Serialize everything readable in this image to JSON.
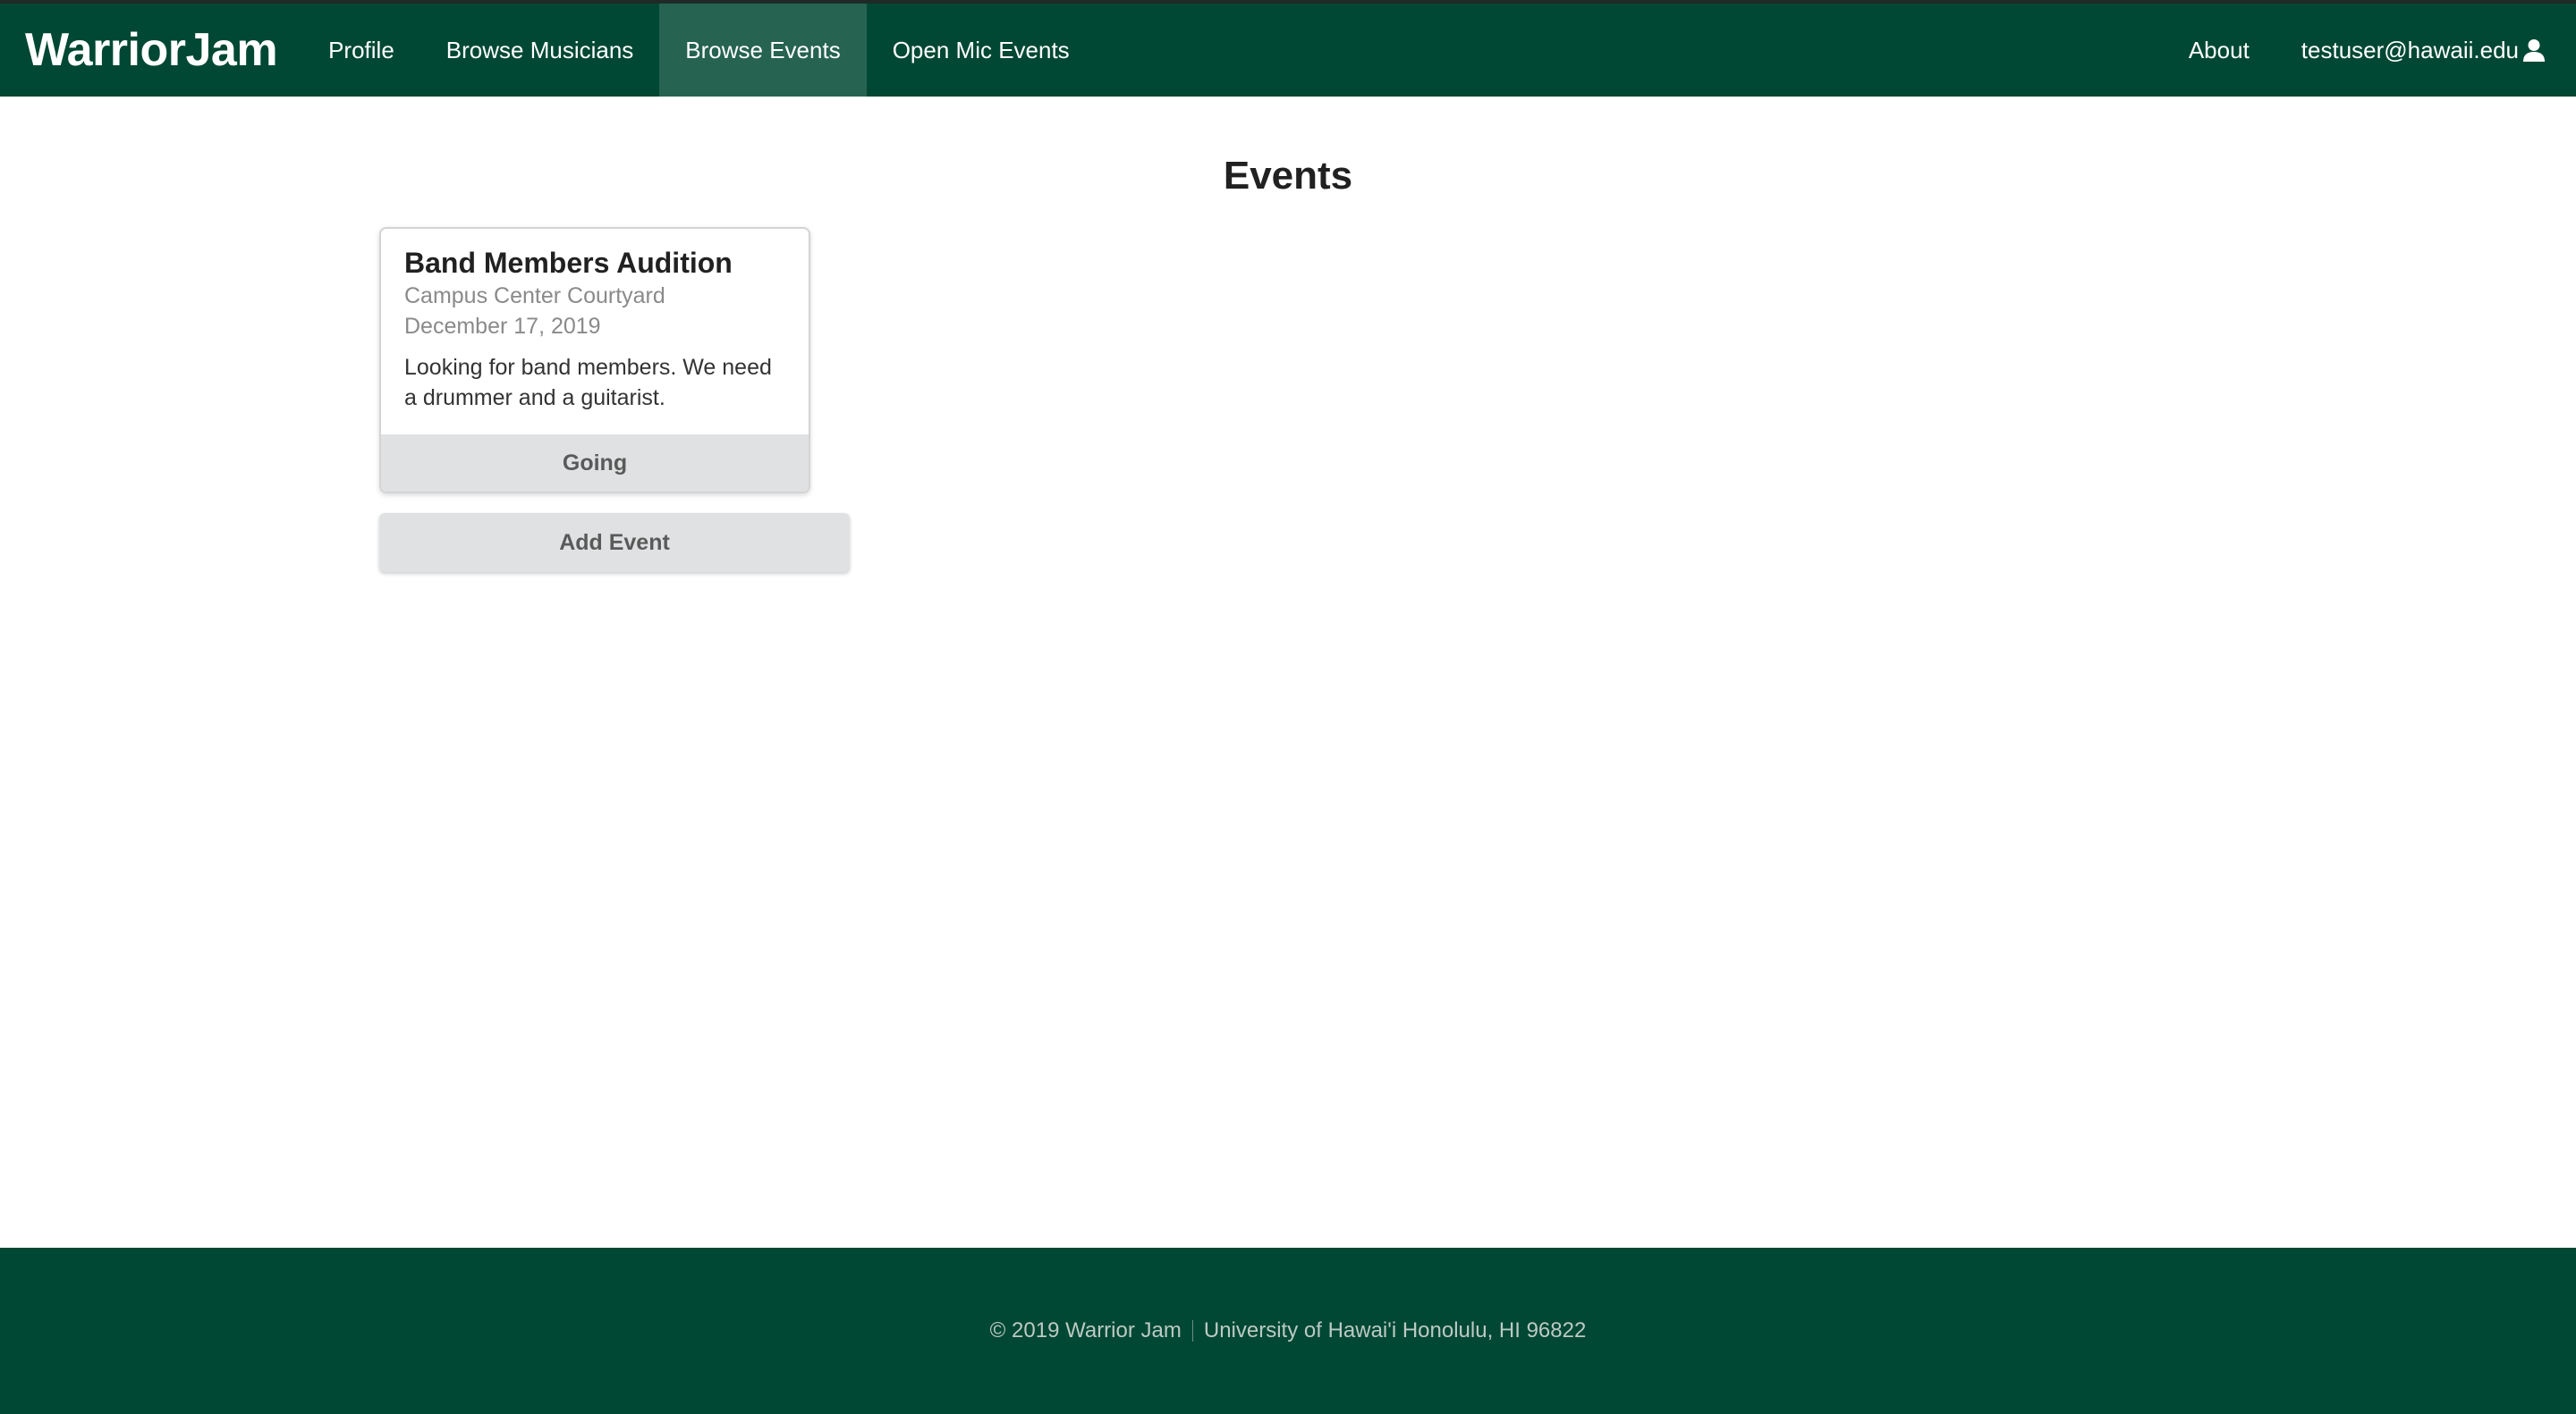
{
  "navbar": {
    "brand": "WarriorJam",
    "items": [
      {
        "label": "Profile"
      },
      {
        "label": "Browse Musicians"
      },
      {
        "label": "Browse Events"
      },
      {
        "label": "Open Mic Events"
      }
    ],
    "active_item": "Browse Events",
    "about_label": "About",
    "user_email": "testuser@hawaii.edu",
    "user_icon": "user-icon"
  },
  "page": {
    "title": "Events"
  },
  "events": [
    {
      "name": "Band Members Audition",
      "location": "Campus Center Courtyard",
      "date": "December 17, 2019",
      "description": "Looking for band members. We need a drummer and a guitarist.",
      "action_label": "Going"
    }
  ],
  "add_event_label": "Add Event",
  "footer": {
    "copyright": "© 2019 Warrior Jam",
    "address": "University of Hawai'i Honolulu, HI 96822"
  },
  "colors": {
    "brand_green": "#004833",
    "button_grey": "#e0e1e2"
  }
}
